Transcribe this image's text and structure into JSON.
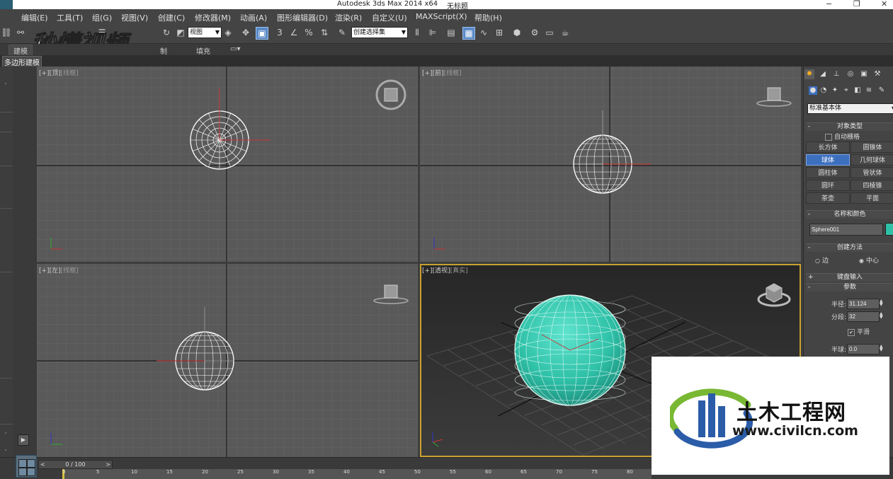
{
  "window": {
    "title": "Autodesk 3ds Max  2014 x64",
    "document": "无标题",
    "minimize": "−",
    "restore": "❐",
    "close": "✕"
  },
  "menu": {
    "items": [
      "编辑(E)",
      "工具(T)",
      "组(G)",
      "视图(V)",
      "创建(C)",
      "修改器(M)",
      "动画(A)",
      "图形编辑器(D)",
      "渲染(R)",
      "自定义(U)",
      "MAXScript(X)",
      "帮助(H)"
    ]
  },
  "toolbar": {
    "reference_coord": "视图",
    "named_selection": "创建选择集"
  },
  "ribbon": {
    "tabs": [
      "建模",
      "",
      "",
      "制",
      "填充"
    ],
    "active_tab": "建模",
    "sub_label": "多边形建模"
  },
  "watermark": {
    "text": "秒懂视频"
  },
  "viewports": {
    "top": {
      "label": "[+]",
      "name": "[顶]",
      "mode": "[线框]"
    },
    "front": {
      "label": "[+]",
      "name": "[前]",
      "mode": "[线框]"
    },
    "left": {
      "label": "[+]",
      "name": "[左]",
      "mode": "[线框]"
    },
    "persp": {
      "label": "[+]",
      "name": "[透视]",
      "mode": "[真实]"
    }
  },
  "command_panel": {
    "category": "标准基本体",
    "object_type_title": "对象类型",
    "auto_grid": "自动栅格",
    "buttons": [
      "长方体",
      "圆锥体",
      "球体",
      "几何球体",
      "圆柱体",
      "管状体",
      "圆环",
      "四棱锥",
      "茶壶",
      "平面"
    ],
    "active_button": "球体",
    "name_color_title": "名称和颜色",
    "object_name": "Sphere001",
    "object_color": "#2fc1a8",
    "creation_method_title": "创建方法",
    "method_edge": "边",
    "method_center": "中心",
    "keyboard_title": "键盘输入",
    "params_title": "参数",
    "radius_label": "半径:",
    "radius_value": "31.124",
    "segments_label": "分段:",
    "segments_value": "32",
    "smooth_label": "平滑",
    "hemisphere_label": "半球:",
    "hemisphere_value": "0.0"
  },
  "timeline": {
    "frame_display": "0 / 100",
    "ticks": [
      "0",
      "5",
      "10",
      "15",
      "20",
      "25",
      "30",
      "35",
      "40",
      "45",
      "50",
      "55",
      "60",
      "65",
      "70",
      "75",
      "80",
      "85"
    ]
  },
  "overlay": {
    "site_name": "土木工程网",
    "site_url": "www.civilcn.com"
  }
}
